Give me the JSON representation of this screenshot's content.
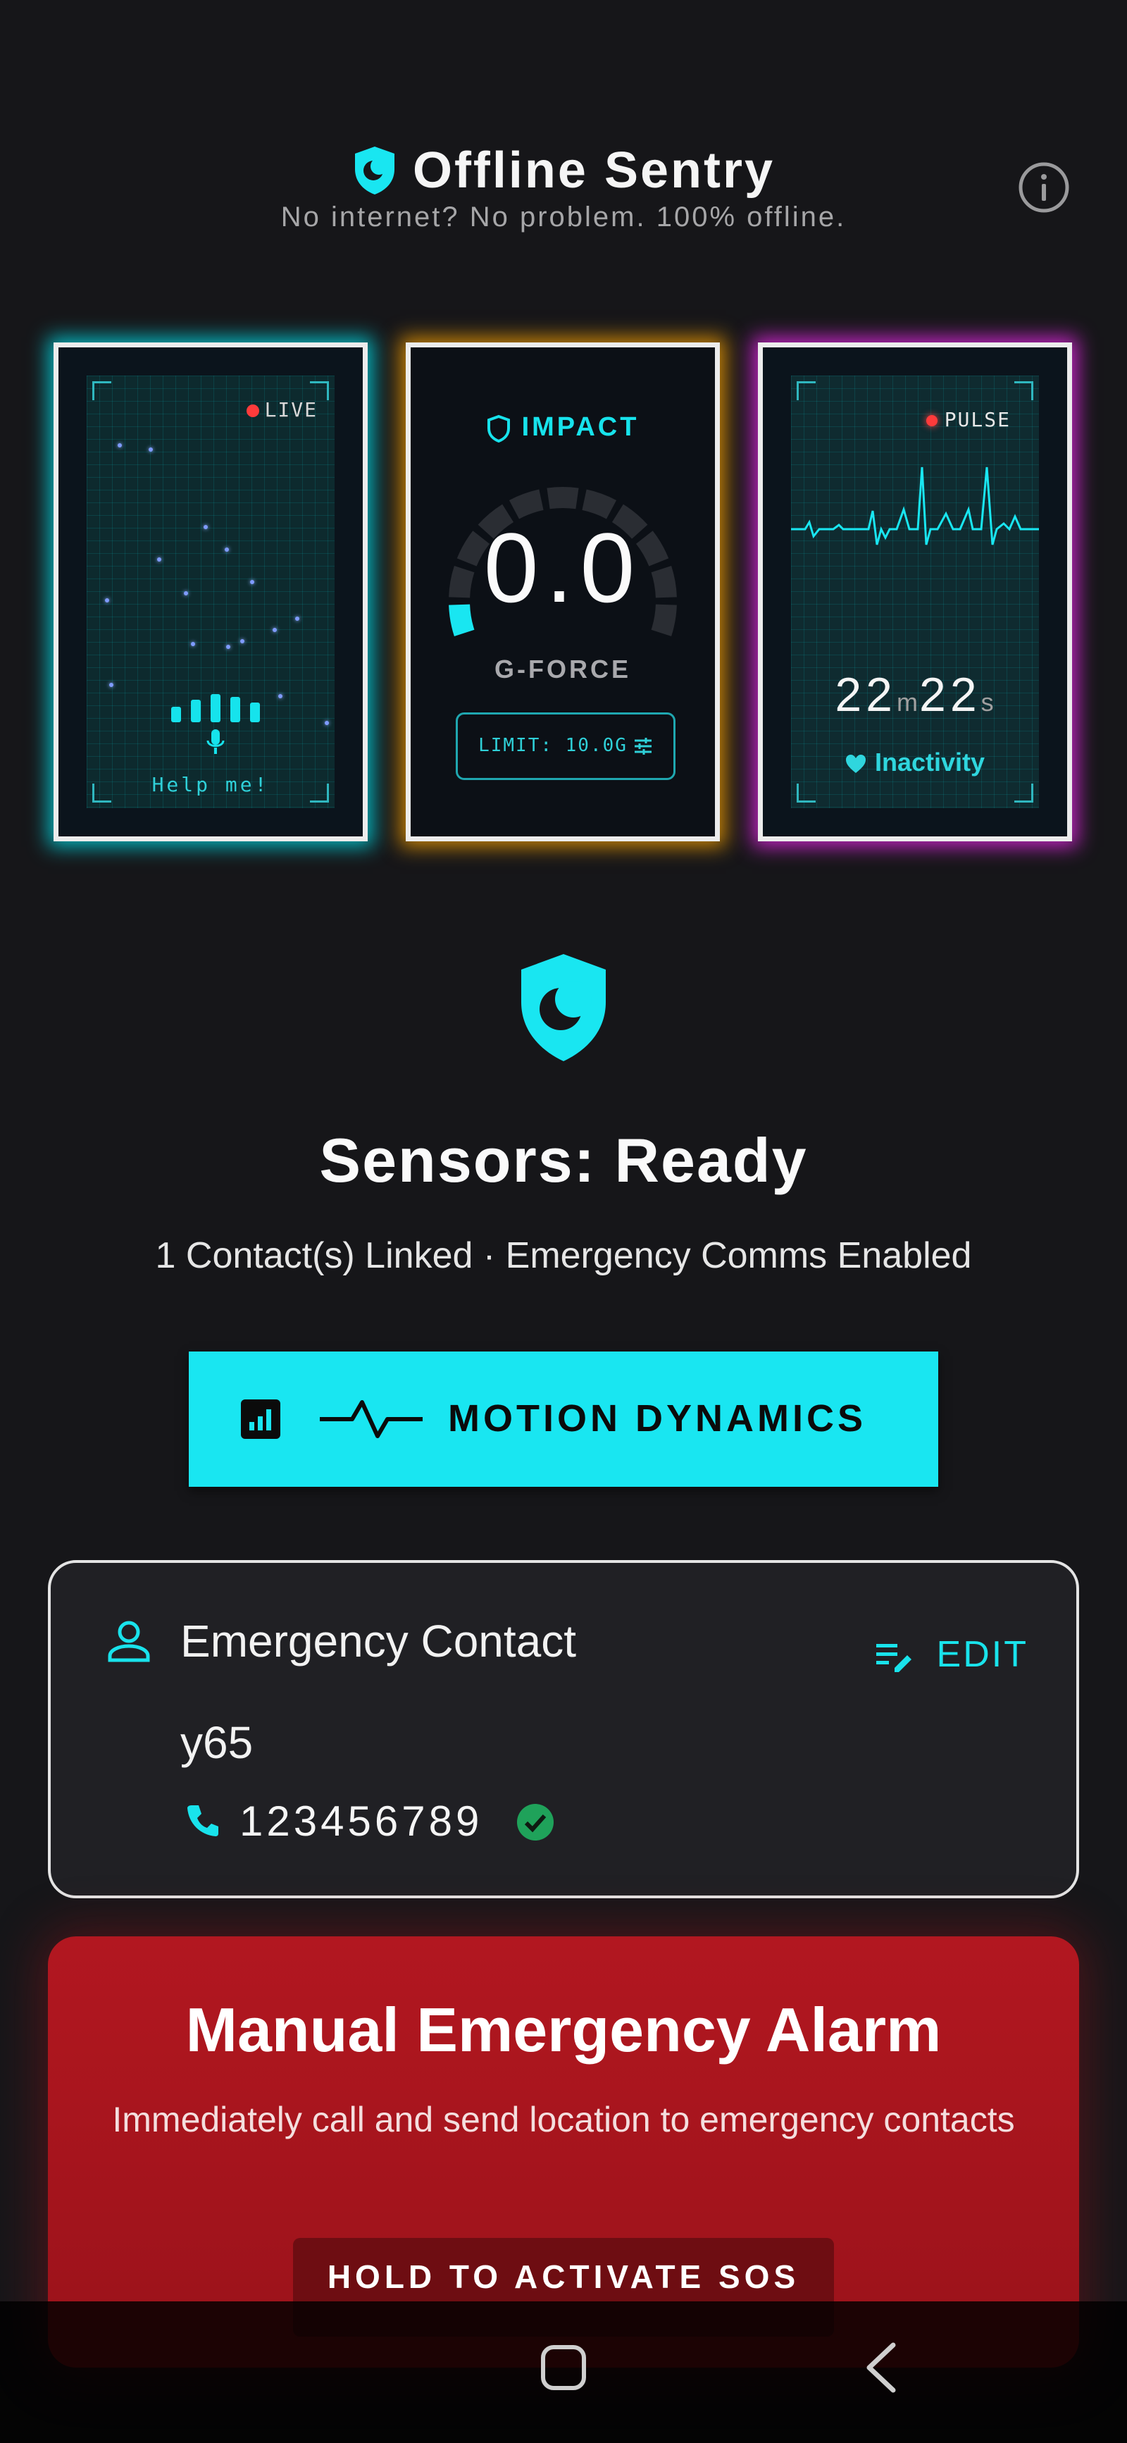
{
  "header": {
    "title": "Offline Sentry",
    "subtitle": "No internet? No problem. 100% offline."
  },
  "cards": {
    "voice": {
      "live_label": "LIVE",
      "phrase": "Help me!"
    },
    "impact": {
      "title": "IMPACT",
      "value": "0.0",
      "unit_label": "G-FORCE",
      "limit_label": "LIMIT: 10.0G",
      "gauge_fraction": 0.0
    },
    "inactivity": {
      "pulse_label": "PULSE",
      "minutes": "22",
      "minutes_unit": "m",
      "seconds": "22",
      "seconds_unit": "s",
      "label": "Inactivity"
    }
  },
  "status": {
    "title": "Sensors: Ready",
    "subtitle": "1 Contact(s) Linked · Emergency Comms Enabled"
  },
  "motion_button": {
    "label": "MOTION DYNAMICS"
  },
  "contact": {
    "header": "Emergency Contact",
    "edit_label": "EDIT",
    "name": "y65",
    "phone": "123456789",
    "verified": true
  },
  "sos": {
    "title": "Manual Emergency Alarm",
    "description": "Immediately call and send location to emergency contacts",
    "button_label": "HOLD TO ACTIVATE SOS"
  },
  "colors": {
    "accent": "#19e6f1",
    "background": "#161619",
    "sos_red": "#b21720",
    "voice_glow": "#00e6f0",
    "impact_glow": "#ffa500",
    "inactivity_glow": "#e628e6",
    "verified_green": "#1fa25a"
  },
  "icons": [
    "shield-icon",
    "info-icon",
    "mic-icon",
    "sliders-icon",
    "heart-icon",
    "bar-chart-icon",
    "pulse-icon",
    "person-icon",
    "edit-list-icon",
    "phone-icon",
    "check-circle-icon",
    "home-icon",
    "back-icon"
  ]
}
